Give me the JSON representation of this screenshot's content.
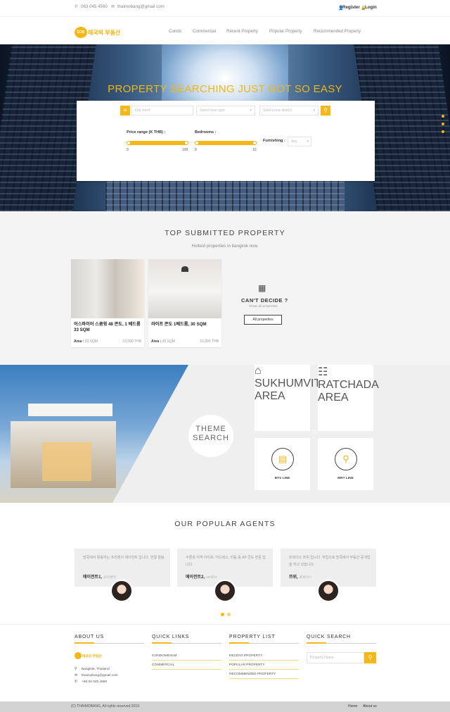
{
  "topbar": {
    "phone": "063 045 4560",
    "email": "thaimobang@gmail.com",
    "register": "Register",
    "login": "Login"
  },
  "brand": {
    "logo_badge": "EOB",
    "logo_text": "태국의 부동산"
  },
  "nav": {
    "items": [
      "Condo",
      "Commercial",
      "Recent Property",
      "Popular Property",
      "Recommended Property"
    ]
  },
  "hero": {
    "title": "PROPERTY SEARCHING JUST GOT SO EASY",
    "keyword_placeholder": "Key word",
    "type_placeholder": "Select your type",
    "district_placeholder": "Select your district",
    "price_label": "Price range (K THB) :",
    "price_min": "0",
    "price_max": "100",
    "bedrooms_label": "Bedrooms :",
    "bed_min": "0",
    "bed_max": "10",
    "furnishing_label": "Furnishing :",
    "furnishing_value": "Any"
  },
  "top": {
    "title": "TOP SUBMITTED PROPERTY",
    "subtitle": "Hottest properties in bangkok now.",
    "cards": [
      {
        "title": "어스파이어 스쿰윗 48 콘도, 1 베드룸 33 SQM",
        "area_label": "Area :",
        "area": "33 SQM",
        "price": "16,000 THB"
      },
      {
        "title": "라이프 콘도 1베드룸, 30 SQM",
        "area_label": "Area :",
        "area": "30 SQM",
        "price": "15,000 THB"
      }
    ],
    "cant_decide": "CAN'T DECIDE ?",
    "show_all": "Show all properties",
    "all_button": "All properties"
  },
  "theme": {
    "line1": "THEME",
    "line2": "SEARCH",
    "tiles": [
      "SUKHUMVIT AREA",
      "RATCHADA AREA",
      "BTS LINE",
      "MRT LINE"
    ]
  },
  "agents": {
    "title": "OUR POPULAR AGENTS",
    "items": [
      {
        "quote": "방콕에서 활동하는 프리랜서 에이전트 입니다. 연결 알림",
        "name": "에이전트1,",
        "role": "프리랜서"
      },
      {
        "quote": "수쿰윗 지역 라이프, 어드레스, 리듬 등 AP 콘도 전문 입니다.",
        "name": "에이전트2,",
        "role": "AP회사"
      },
      {
        "quote": "트와이스 쯔위 입니다. 부업으로 방콕에서 부동산 중개업을 하고 있습니다.",
        "name": "쯔위,",
        "role": "트와이스"
      }
    ]
  },
  "footer": {
    "about_title": "ABOUT US",
    "location": "Bangkok, Thailand",
    "email": "thaimobang@gmail.com",
    "phone": "+66 63 045 4560",
    "quick_title": "QUICK LINKS",
    "quick": [
      "CONDOMINIUM",
      "COMMERCIAL"
    ],
    "plist_title": "PROPERTY LIST",
    "plist": [
      "RECENT PROPERTY",
      "POPULAR PROPERTY",
      "RECOMMENDED PROPERTY"
    ],
    "qsearch_title": "QUICK SEARCH",
    "qsearch_placeholder": "Property Name"
  },
  "bottom": {
    "copyright": "(C) THAIMOBANG, All rights reserved 2019",
    "home": "Home",
    "about": "About us"
  },
  "colors": {
    "accent": "#f5b71a"
  }
}
